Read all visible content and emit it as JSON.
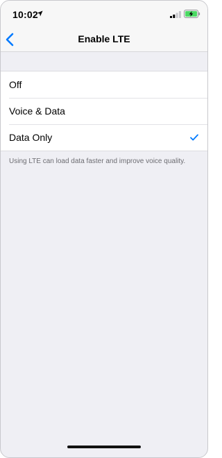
{
  "status_bar": {
    "time": "10:02",
    "location_icon": "location-arrow-icon",
    "signal_icon": "cellular-signal-icon",
    "battery_icon": "battery-charging-icon",
    "battery_color": "#4cd964"
  },
  "nav": {
    "back_icon": "chevron-left-icon",
    "title": "Enable LTE",
    "accent_color": "#007aff"
  },
  "options": [
    {
      "label": "Off",
      "selected": false
    },
    {
      "label": "Voice & Data",
      "selected": false
    },
    {
      "label": "Data Only",
      "selected": true
    }
  ],
  "checkmark_icon": "checkmark-icon",
  "footer_note": "Using LTE can load data faster and improve voice quality."
}
